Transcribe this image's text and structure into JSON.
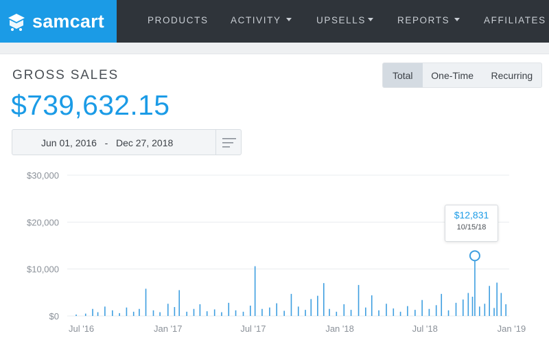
{
  "app": {
    "brand": "samcart",
    "nav": [
      {
        "label": "PRODUCTS",
        "dropdown": false
      },
      {
        "label": "ACTIVITY",
        "dropdown": true
      },
      {
        "label": "UPSELLS",
        "dropdown": true
      },
      {
        "label": "REPORTS",
        "dropdown": true
      },
      {
        "label": "AFFILIATES",
        "dropdown": false
      }
    ]
  },
  "report": {
    "title": "GROSS SALES",
    "total": "$739,632.15",
    "toggle": [
      {
        "label": "Total",
        "active": true
      },
      {
        "label": "One-Time",
        "active": false
      },
      {
        "label": "Recurring",
        "active": false
      }
    ],
    "date_range": {
      "start": "Jun 01, 2016",
      "separator": "-",
      "end": "Dec 27, 2018"
    }
  },
  "tooltip": {
    "value": "$12,831",
    "date": "10/15/18"
  },
  "colors": {
    "brand": "#1b9be6",
    "nav_bg": "#2f343a",
    "bar": "#3d9ee0"
  },
  "icons": {
    "logo": "cart-logo-icon",
    "filter": "filter-lines-icon"
  },
  "chart_data": {
    "type": "bar",
    "y_ticks": [
      "$30,000",
      "$20,000",
      "$10,000",
      "$0"
    ],
    "x_ticks": [
      "Jul '16",
      "Jan '17",
      "Jul '17",
      "Jan '18",
      "Jul '18",
      "Jan '19"
    ],
    "ylim": [
      0,
      30000
    ],
    "xlim": [
      "2016-06-01",
      "2018-12-27"
    ],
    "grid": true,
    "highlight": {
      "x": "2018-10-15",
      "y": 12831
    },
    "series": [
      {
        "points": [
          [
            "2016-06-20",
            300
          ],
          [
            "2016-07-10",
            500
          ],
          [
            "2016-07-25",
            1500
          ],
          [
            "2016-08-05",
            800
          ],
          [
            "2016-08-20",
            2000
          ],
          [
            "2016-09-05",
            1200
          ],
          [
            "2016-09-20",
            600
          ],
          [
            "2016-10-05",
            1800
          ],
          [
            "2016-10-20",
            900
          ],
          [
            "2016-11-01",
            1500
          ],
          [
            "2016-11-15",
            5800
          ],
          [
            "2016-12-01",
            1200
          ],
          [
            "2016-12-15",
            800
          ],
          [
            "2017-01-01",
            2600
          ],
          [
            "2017-01-15",
            1900
          ],
          [
            "2017-01-25",
            5500
          ],
          [
            "2017-02-10",
            900
          ],
          [
            "2017-02-25",
            1500
          ],
          [
            "2017-03-10",
            2500
          ],
          [
            "2017-03-25",
            1000
          ],
          [
            "2017-04-10",
            1400
          ],
          [
            "2017-04-25",
            800
          ],
          [
            "2017-05-10",
            2800
          ],
          [
            "2017-05-25",
            1200
          ],
          [
            "2017-06-10",
            900
          ],
          [
            "2017-06-25",
            2200
          ],
          [
            "2017-07-05",
            10600
          ],
          [
            "2017-07-20",
            1500
          ],
          [
            "2017-08-05",
            1800
          ],
          [
            "2017-08-20",
            2700
          ],
          [
            "2017-09-05",
            1100
          ],
          [
            "2017-09-20",
            4700
          ],
          [
            "2017-10-05",
            2000
          ],
          [
            "2017-10-20",
            1300
          ],
          [
            "2017-11-01",
            3600
          ],
          [
            "2017-11-15",
            4300
          ],
          [
            "2017-11-28",
            7000
          ],
          [
            "2017-12-10",
            1500
          ],
          [
            "2017-12-25",
            900
          ],
          [
            "2018-01-10",
            2500
          ],
          [
            "2018-01-25",
            1300
          ],
          [
            "2018-02-10",
            6600
          ],
          [
            "2018-02-25",
            1800
          ],
          [
            "2018-03-10",
            4400
          ],
          [
            "2018-03-25",
            1200
          ],
          [
            "2018-04-10",
            2600
          ],
          [
            "2018-04-25",
            1600
          ],
          [
            "2018-05-10",
            900
          ],
          [
            "2018-05-25",
            2100
          ],
          [
            "2018-06-10",
            1300
          ],
          [
            "2018-06-25",
            3400
          ],
          [
            "2018-07-10",
            1500
          ],
          [
            "2018-07-25",
            2300
          ],
          [
            "2018-08-05",
            4700
          ],
          [
            "2018-08-20",
            1200
          ],
          [
            "2018-09-05",
            2800
          ],
          [
            "2018-09-20",
            3500
          ],
          [
            "2018-10-01",
            4900
          ],
          [
            "2018-10-10",
            4100
          ],
          [
            "2018-10-15",
            12831
          ],
          [
            "2018-10-25",
            2000
          ],
          [
            "2018-11-05",
            2600
          ],
          [
            "2018-11-15",
            6400
          ],
          [
            "2018-11-25",
            1700
          ],
          [
            "2018-12-01",
            7100
          ],
          [
            "2018-12-10",
            4900
          ],
          [
            "2018-12-20",
            2500
          ]
        ]
      }
    ]
  }
}
